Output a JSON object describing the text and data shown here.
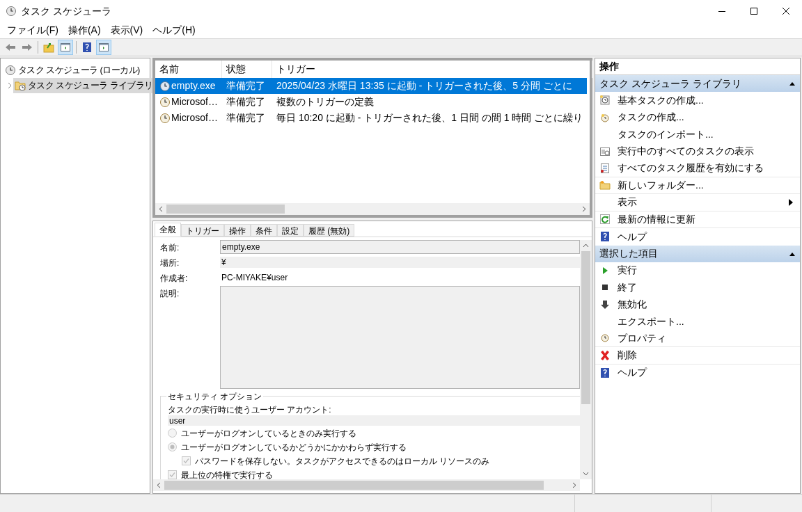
{
  "window": {
    "title": "タスク スケジューラ"
  },
  "menu": [
    "ファイル(F)",
    "操作(A)",
    "表示(V)",
    "ヘルプ(H)"
  ],
  "tree": [
    {
      "label": "タスク スケジューラ (ローカル)",
      "selected": false,
      "children": [
        {
          "label": "タスク スケジューラ ライブラリ",
          "selected": true
        }
      ]
    }
  ],
  "task_list": {
    "columns": [
      "名前",
      "状態",
      "トリガー"
    ],
    "rows": [
      {
        "cells": [
          "empty.exe",
          "準備完了",
          "2025/04/23 水曜日 13:35 に起動 - トリガーされた後、5 分間 ごとに"
        ],
        "selected": true
      },
      {
        "cells": [
          "Microsof…",
          "準備完了",
          "複数のトリガーの定義"
        ],
        "selected": false
      },
      {
        "cells": [
          "Microsof…",
          "準備完了",
          "毎日 10:20 に起動 - トリガーされた後、1 日間 の間 1 時間 ごとに繰り"
        ],
        "selected": false
      }
    ]
  },
  "details": {
    "tabs": [
      {
        "label": "全般",
        "selected": true
      },
      {
        "label": "トリガー",
        "selected": false
      },
      {
        "label": "操作",
        "selected": false
      },
      {
        "label": "条件",
        "selected": false
      },
      {
        "label": "設定",
        "selected": false
      },
      {
        "label": "履歴 (無効)",
        "selected": false
      }
    ],
    "name_label": "名前:",
    "name_value": "empty.exe",
    "location_label": "場所:",
    "location_value": "¥",
    "author_label": "作成者:",
    "author_value": "PC-MIYAKE¥user",
    "description_label": "説明:",
    "security": {
      "legend": "セキュリティ オプション",
      "account_label": "タスクの実行時に使うユーザー アカウント:",
      "account_value": "user",
      "options": [
        {
          "kind": "radio",
          "label": "ユーザーがログオンしているときのみ実行する",
          "checked": false
        },
        {
          "kind": "radio",
          "label": "ユーザーがログオンしているかどうかにかかわらず実行する",
          "checked": true,
          "children": [
            {
              "kind": "checkbox",
              "label": "パスワードを保存しない。タスクがアクセスできるのはローカル リソースのみ",
              "checked": true
            }
          ]
        },
        {
          "kind": "checkbox",
          "label": "最上位の特権で実行する",
          "checked": true
        }
      ]
    }
  },
  "actions": {
    "title": "操作",
    "sections": [
      {
        "title": "タスク スケジューラ ライブラリ",
        "expanded": true,
        "items": [
          {
            "label": "基本タスクの作成...",
            "submenu": false
          },
          {
            "label": "タスクの作成...",
            "submenu": false
          },
          {
            "label": "タスクのインポート...",
            "submenu": false
          },
          {
            "label": "実行中のすべてのタスクの表示",
            "submenu": false
          },
          {
            "label": "すべてのタスク履歴を有効にする",
            "submenu": false
          },
          {
            "label": "新しいフォルダー...",
            "submenu": false
          },
          {
            "label": "表示",
            "submenu": true
          },
          {
            "label": "最新の情報に更新",
            "submenu": false
          },
          {
            "label": "ヘルプ",
            "submenu": false
          }
        ]
      },
      {
        "title": "選択した項目",
        "expanded": true,
        "items": [
          {
            "label": "実行",
            "submenu": false
          },
          {
            "label": "終了",
            "submenu": false
          },
          {
            "label": "無効化",
            "submenu": false
          },
          {
            "label": "エクスポート...",
            "submenu": false
          },
          {
            "label": "プロパティ",
            "submenu": false
          },
          {
            "label": "削除",
            "submenu": false
          },
          {
            "label": "ヘルプ",
            "submenu": false
          }
        ]
      }
    ]
  }
}
